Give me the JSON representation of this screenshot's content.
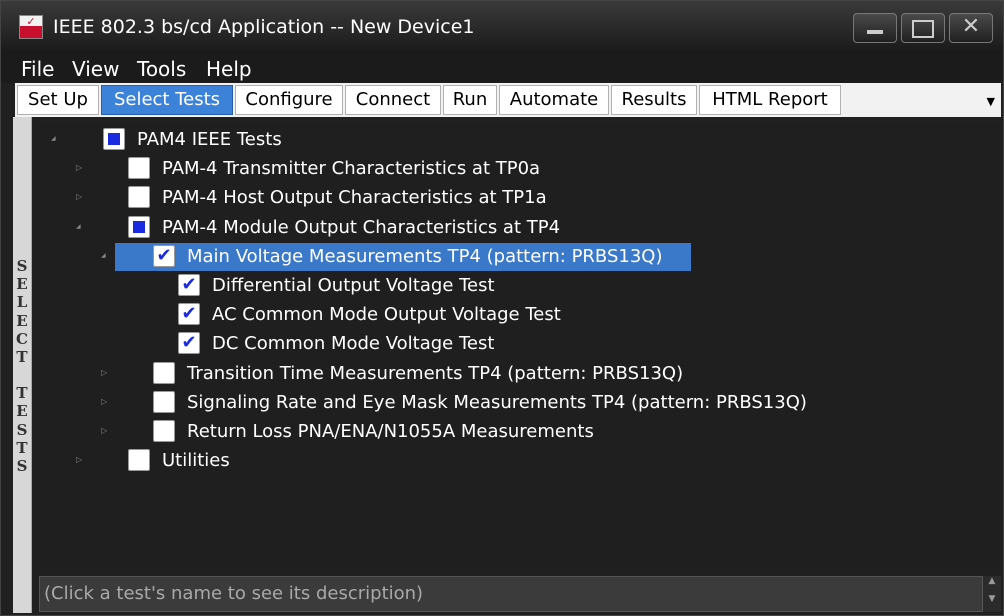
{
  "window": {
    "title": "IEEE 802.3 bs/cd Application -- New Device1",
    "icon": "keysight-app-icon"
  },
  "menu": [
    "File",
    "View",
    "Tools",
    "Help"
  ],
  "tabs": [
    "Set Up",
    "Select Tests",
    "Configure",
    "Connect",
    "Run",
    "Automate",
    "Results",
    "HTML Report"
  ],
  "active_tab": "Select Tests",
  "side_label": "SELECT TESTS",
  "tree": [
    {
      "label": "PAM4 IEEE Tests",
      "level": 0,
      "state": "partial",
      "expander": "expanded"
    },
    {
      "label": "PAM-4 Transmitter Characteristics at TP0a",
      "level": 1,
      "state": "unchecked",
      "expander": "collapsed"
    },
    {
      "label": "PAM-4 Host Output Characteristics at TP1a",
      "level": 1,
      "state": "unchecked",
      "expander": "collapsed"
    },
    {
      "label": "PAM-4 Module Output Characteristics at TP4",
      "level": 1,
      "state": "partial",
      "expander": "expanded"
    },
    {
      "label": "Main Voltage Measurements TP4 (pattern: PRBS13Q)",
      "level": 2,
      "state": "checked",
      "expander": "expanded",
      "selected": true
    },
    {
      "label": "Differential Output Voltage Test",
      "level": 3,
      "state": "checked"
    },
    {
      "label": "AC Common Mode Output Voltage Test",
      "level": 3,
      "state": "checked"
    },
    {
      "label": "DC Common Mode Voltage Test",
      "level": 3,
      "state": "checked"
    },
    {
      "label": "Transition Time Measurements TP4 (pattern: PRBS13Q)",
      "level": 2,
      "state": "unchecked",
      "expander": "collapsed"
    },
    {
      "label": "Signaling Rate and Eye Mask Measurements TP4 (pattern: PRBS13Q)",
      "level": 2,
      "state": "unchecked",
      "expander": "collapsed"
    },
    {
      "label": "Return Loss PNA/ENA/N1055A Measurements",
      "level": 2,
      "state": "unchecked",
      "expander": "collapsed"
    },
    {
      "label": "Utilities",
      "level": 1,
      "state": "unchecked",
      "expander": "collapsed"
    }
  ],
  "description": {
    "text": "(Click a test's name to see its description)"
  },
  "colors": {
    "accent": "#3c82d8",
    "selection": "#3a78c9",
    "checkbox_fill": "#1a2be0"
  }
}
